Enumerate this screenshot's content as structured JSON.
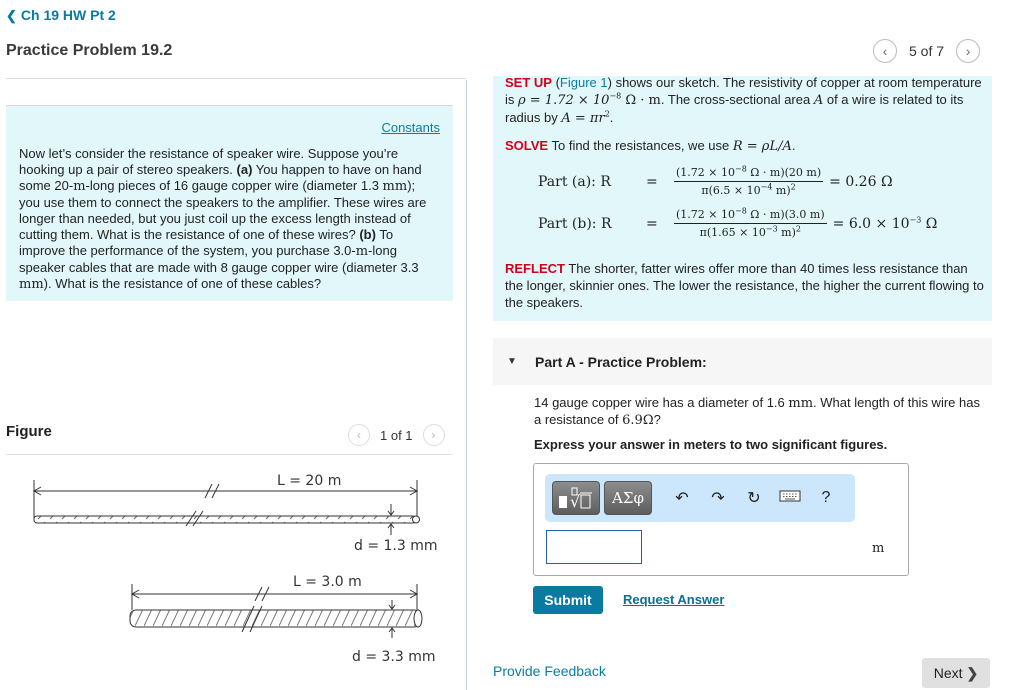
{
  "header": {
    "back_label": "Ch 19 HW Pt 2",
    "title": "Practice Problem 19.2",
    "pager": {
      "current": 5,
      "total": 7,
      "text": "5 of 7"
    }
  },
  "problem": {
    "constants_link": "Constants",
    "text_parts": [
      {
        "t": "Now let’s consider the resistance of speaker wire. Suppose you’re hooking up a pair of stereo speakers. "
      },
      {
        "t": "(a)",
        "b": true
      },
      {
        "t": " You happen to have on hand some 20-"
      },
      {
        "t": "m",
        "m": true
      },
      {
        "t": "-long pieces of 16 gauge copper wire (diameter 1.3 "
      },
      {
        "t": "mm",
        "m": true
      },
      {
        "t": "); you use them to connect the speakers to the amplifier. These wires are longer than needed, but you just coil up the excess length instead of cutting them. What is the resistance of one of these wires? "
      },
      {
        "t": "(b)",
        "b": true
      },
      {
        "t": " To improve the performance of the system, you purchase 3.0-"
      },
      {
        "t": "m",
        "m": true
      },
      {
        "t": "-long speaker cables that are made with 8 gauge copper wire (diameter 3.3 "
      },
      {
        "t": "mm",
        "m": true
      },
      {
        "t": "). What is the resistance of one of these cables?"
      }
    ]
  },
  "figure": {
    "title": "Figure",
    "pager_text": "1 of 1",
    "wire_a": {
      "length_label": "L = 20 m",
      "diameter_label": "d = 1.3 mm"
    },
    "wire_b": {
      "length_label": "L = 3.0 m",
      "diameter_label": "d = 3.3 mm"
    }
  },
  "solution": {
    "setup_label": "SET UP",
    "setup_link": "Figure 1",
    "setup_text_1": " shows our sketch. The resistivity of copper at room temperature is ",
    "rho_expr": "ρ = 1.72 × 10",
    "rho_exp": "−8",
    "rho_unit": " Ω · m",
    "setup_text_2": ". The cross-sectional area ",
    "area_var": "A",
    "setup_text_3": " of a wire is related to its radius by ",
    "area_expr": "A = πr",
    "area_exp": "2",
    "solve_label": "SOLVE",
    "solve_text": " To find the resistances, we use ",
    "solve_expr": "R = ρL/A",
    "part_a": {
      "label": "Part (a): R",
      "num": "(1.72 × 10",
      "num_exp": "−8",
      "num_tail": " Ω · m)(20 m)",
      "den": "π(6.5 × 10",
      "den_exp": "−4",
      "den_tail": " m)",
      "den_pow": "2",
      "result": "= 0.26 Ω"
    },
    "part_b": {
      "label": "Part (b): R",
      "num": "(1.72 × 10",
      "num_exp": "−8",
      "num_tail": " Ω · m)(3.0 m)",
      "den": "π(1.65 × 10",
      "den_exp": "−3",
      "den_tail": " m)",
      "den_pow": "2",
      "result": "= 6.0 × 10",
      "result_exp": "−3",
      "result_unit": " Ω"
    },
    "reflect_label": "REFLECT",
    "reflect_text": " The shorter, fatter wires offer more than 40 times less resistance than the longer, skinnier ones. The lower the resistance, the higher the current flowing to the speakers."
  },
  "part_a": {
    "header": "Part A - Practice Problem:",
    "question_1": "14 gauge copper wire has a diameter of 1.6 ",
    "question_unit": "mm",
    "question_2": ". What length of this wire has a resistance of ",
    "question_value": "6.9Ω",
    "question_3": "?",
    "instruction": "Express your answer in meters to two significant figures.",
    "toolbar": {
      "greek_label": "ΑΣφ",
      "help_label": "?"
    },
    "answer_value": "",
    "unit": "m",
    "submit_label": "Submit",
    "request_answer_label": "Request Answer"
  },
  "footer": {
    "feedback_label": "Provide Feedback",
    "next_label": "Next"
  }
}
